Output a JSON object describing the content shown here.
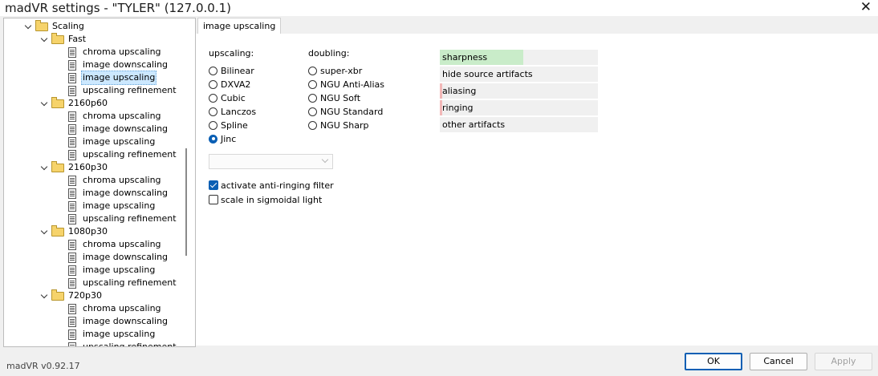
{
  "window": {
    "title": "madVR settings - \"TYLER\" (127.0.0.1)",
    "close_glyph": "✕"
  },
  "tree": {
    "items": [
      {
        "label": "Scaling",
        "type": "folder",
        "indent": 1,
        "expanded": true
      },
      {
        "label": "Fast",
        "type": "folder",
        "indent": 2,
        "expanded": true
      },
      {
        "label": "chroma upscaling",
        "type": "page",
        "indent": 3
      },
      {
        "label": "image downscaling",
        "type": "page",
        "indent": 3
      },
      {
        "label": "image upscaling",
        "type": "page",
        "indent": 3,
        "selected": true
      },
      {
        "label": "upscaling refinement",
        "type": "page",
        "indent": 3
      },
      {
        "label": "2160p60",
        "type": "folder",
        "indent": 2,
        "expanded": true
      },
      {
        "label": "chroma upscaling",
        "type": "page",
        "indent": 3
      },
      {
        "label": "image downscaling",
        "type": "page",
        "indent": 3
      },
      {
        "label": "image upscaling",
        "type": "page",
        "indent": 3
      },
      {
        "label": "upscaling refinement",
        "type": "page",
        "indent": 3
      },
      {
        "label": "2160p30",
        "type": "folder",
        "indent": 2,
        "expanded": true
      },
      {
        "label": "chroma upscaling",
        "type": "page",
        "indent": 3
      },
      {
        "label": "image downscaling",
        "type": "page",
        "indent": 3
      },
      {
        "label": "image upscaling",
        "type": "page",
        "indent": 3
      },
      {
        "label": "upscaling refinement",
        "type": "page",
        "indent": 3
      },
      {
        "label": "1080p30",
        "type": "folder",
        "indent": 2,
        "expanded": true
      },
      {
        "label": "chroma upscaling",
        "type": "page",
        "indent": 3
      },
      {
        "label": "image downscaling",
        "type": "page",
        "indent": 3
      },
      {
        "label": "image upscaling",
        "type": "page",
        "indent": 3
      },
      {
        "label": "upscaling refinement",
        "type": "page",
        "indent": 3
      },
      {
        "label": "720p30",
        "type": "folder",
        "indent": 2,
        "expanded": true
      },
      {
        "label": "chroma upscaling",
        "type": "page",
        "indent": 3
      },
      {
        "label": "image downscaling",
        "type": "page",
        "indent": 3
      },
      {
        "label": "image upscaling",
        "type": "page",
        "indent": 3
      },
      {
        "label": "upscaling refinement",
        "type": "page",
        "indent": 3
      }
    ]
  },
  "tab": {
    "label": "image upscaling"
  },
  "upscaling": {
    "label": "upscaling:",
    "options": [
      {
        "label": "Bilinear",
        "checked": false
      },
      {
        "label": "DXVA2",
        "checked": false
      },
      {
        "label": "Cubic",
        "checked": false
      },
      {
        "label": "Lanczos",
        "checked": false
      },
      {
        "label": "Spline",
        "checked": false
      },
      {
        "label": "Jinc",
        "checked": true
      }
    ]
  },
  "doubling": {
    "label": "doubling:",
    "options": [
      {
        "label": "super-xbr",
        "checked": false
      },
      {
        "label": "NGU Anti-Alias",
        "checked": false
      },
      {
        "label": "NGU Soft",
        "checked": false
      },
      {
        "label": "NGU Standard",
        "checked": false
      },
      {
        "label": "NGU Sharp",
        "checked": false
      }
    ]
  },
  "combo": {
    "value": ""
  },
  "checkboxes": [
    {
      "label": "activate anti-ringing filter",
      "checked": true
    },
    {
      "label": "scale in sigmoidal light",
      "checked": false
    }
  ],
  "quality": {
    "bars": [
      {
        "label": "sharpness",
        "level": 0.53,
        "color": "#c9ecc9"
      },
      {
        "label": "hide source artifacts",
        "level": 0.0,
        "color": "#f0f0f0"
      },
      {
        "label": "aliasing",
        "level": 0.015,
        "color": "#f2b8b8"
      },
      {
        "label": "ringing",
        "level": 0.015,
        "color": "#f2b8b8"
      },
      {
        "label": "other artifacts",
        "level": 0.0,
        "color": "#f0f0f0"
      }
    ]
  },
  "footer": {
    "version": "madVR v0.92.17",
    "ok_label": "OK",
    "cancel_label": "Cancel",
    "apply_label": "Apply"
  },
  "colors": {
    "accent": "#0a5fb4",
    "selection": "#cce8ff"
  }
}
